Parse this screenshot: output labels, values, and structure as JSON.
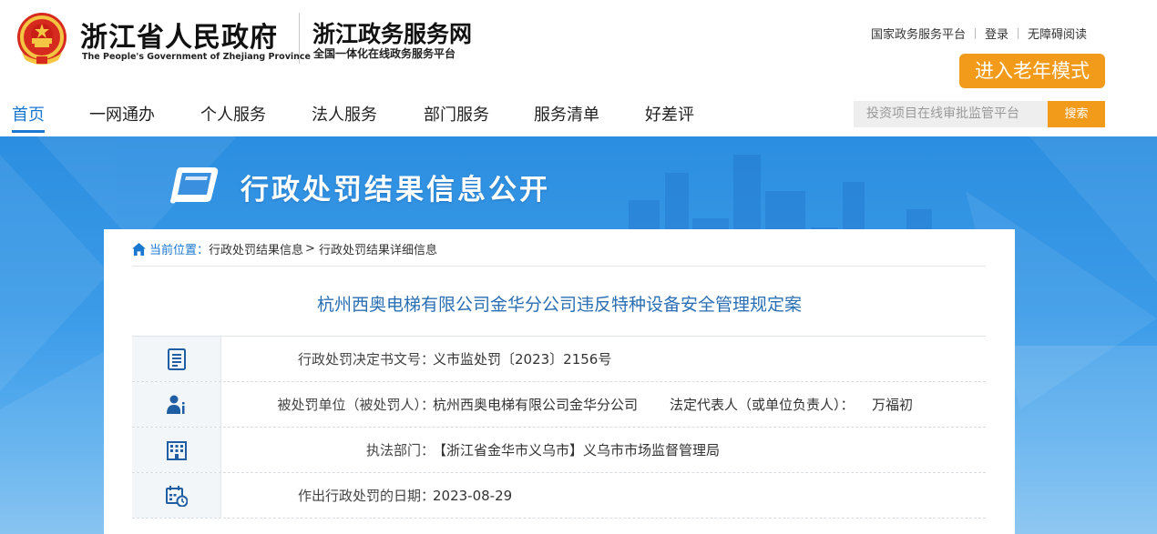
{
  "header": {
    "gov_name": "浙江省人民政府",
    "gov_name_en": "The People's Government of Zhejiang Province",
    "service_name": "浙江政务服务网",
    "service_sub": "全国一体化在线政务服务平台",
    "links": [
      "国家政务服务平台",
      "登录",
      "无障碍阅读"
    ],
    "elder_mode": "进入老年模式"
  },
  "nav": {
    "items": [
      "首页",
      "一网通办",
      "个人服务",
      "法人服务",
      "部门服务",
      "服务清单",
      "好差评"
    ],
    "active_index": 0
  },
  "search": {
    "placeholder": "投资项目在线审批监管平台",
    "button": "搜索"
  },
  "banner": {
    "title": "行政处罚结果信息公开"
  },
  "breadcrumb": {
    "label": "当前位置：",
    "items": [
      "行政处罚结果信息",
      "行政处罚结果详细信息"
    ],
    "separator": ">"
  },
  "case": {
    "title": "杭州西奥电梯有限公司金华分公司违反特种设备安全管理规定案",
    "rows": [
      {
        "icon": "document-icon",
        "label": "行政处罚决定书文号：",
        "value": "义市监处罚〔2023〕2156号"
      },
      {
        "icon": "person-icon",
        "label": "被处罚单位（被处罚人）：",
        "value": "杭州西奥电梯有限公司金华分公司",
        "label2": "法定代表人（或单位负责人）：",
        "value2": "万福初"
      },
      {
        "icon": "building-icon",
        "label": "执法部门：",
        "value": "【浙江省金华市义乌市】义乌市市场监督管理局"
      },
      {
        "icon": "calendar-clock-icon",
        "label": "作出行政处罚的日期：",
        "value": "2023-08-29"
      }
    ]
  },
  "colors": {
    "accent_blue": "#1b78d0",
    "orange": "#f29a1a",
    "title_blue": "#2a6fb3"
  }
}
